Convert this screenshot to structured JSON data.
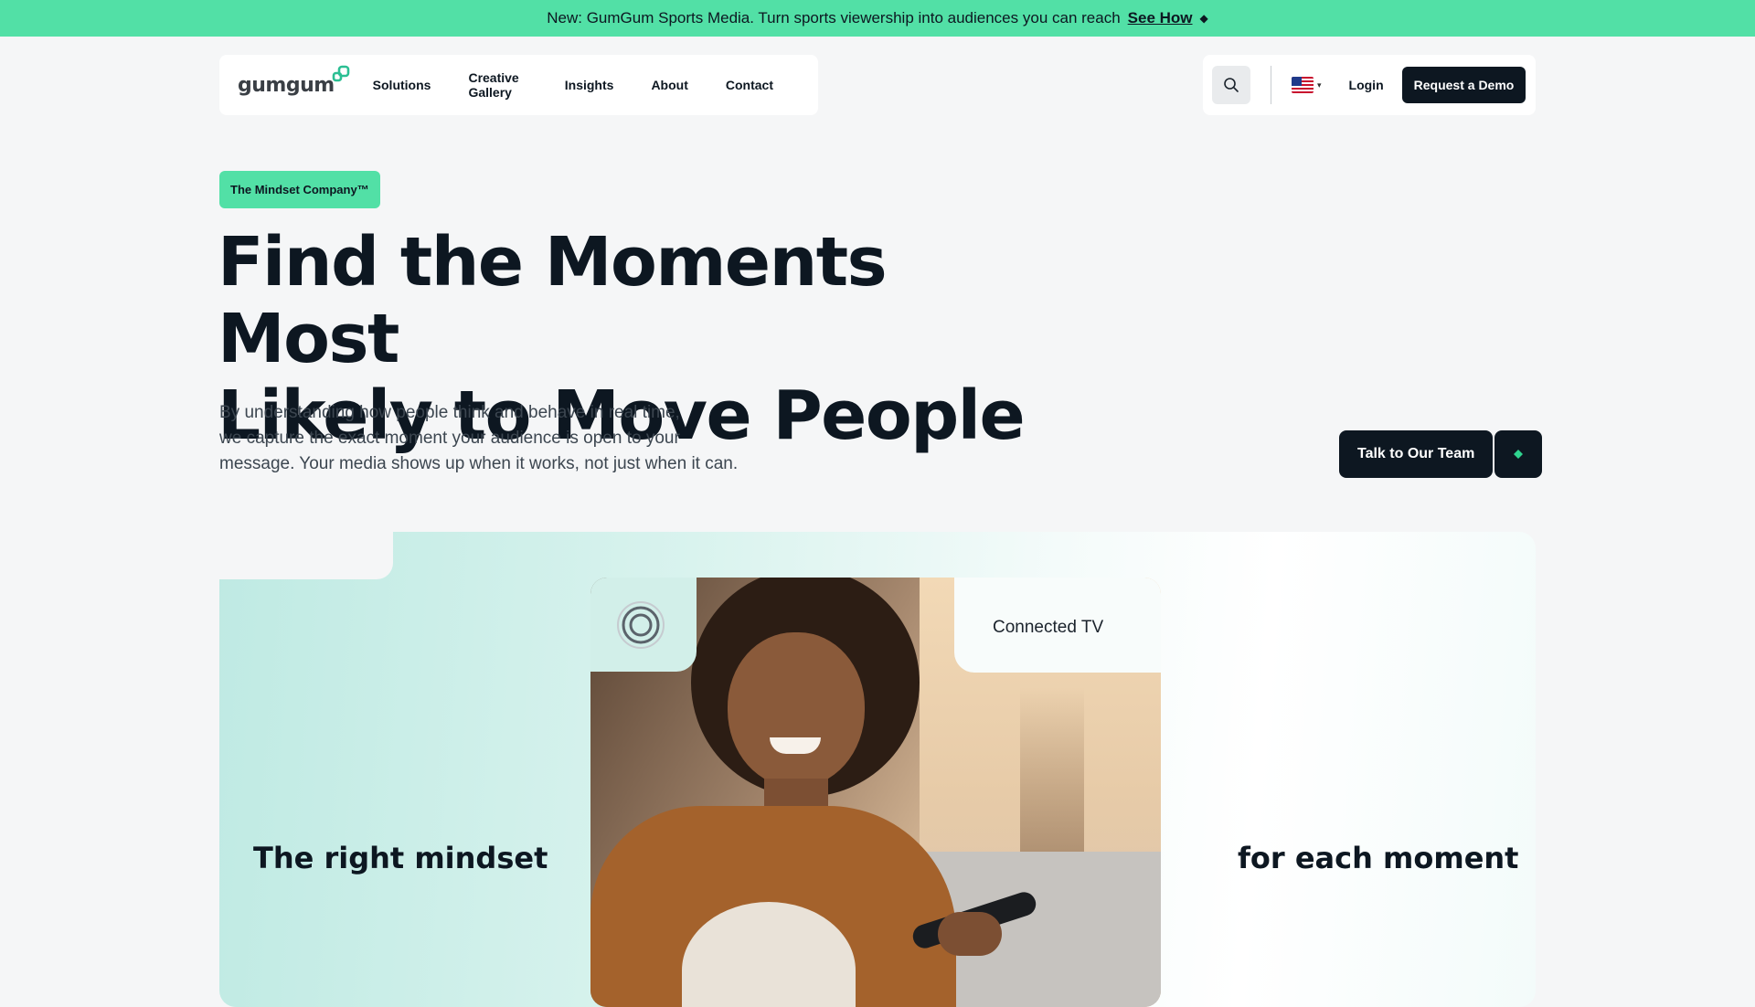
{
  "announcement": {
    "text": "New: GumGum Sports Media. Turn sports viewership into audiences you can reach",
    "link_label": "See How",
    "icon": "diamond-icon"
  },
  "nav": {
    "logo_text": "gumgum",
    "items": [
      {
        "label": "Solutions"
      },
      {
        "label": "Creative Gallery"
      },
      {
        "label": "Insights"
      },
      {
        "label": "About"
      },
      {
        "label": "Contact"
      }
    ],
    "search_icon": "search-icon",
    "language_icon": "us-flag-icon",
    "login_label": "Login",
    "demo_label": "Request a Demo"
  },
  "hero": {
    "badge": "The Mindset Company™",
    "headline_line1": "Find the Moments Most",
    "headline_line2": "Likely to Move People",
    "sub_line1": "By understanding how people think and behave in real time,",
    "sub_line2": "we capture the exact moment your audience is open to your",
    "sub_line3": "message. Your media shows up when it works, not just when it can.",
    "cta_label": "Talk to Our Team",
    "cta_icon": "diamond-icon"
  },
  "showcase": {
    "channel_label": "Connected TV",
    "left_tag": "The right mindset",
    "right_tag": "for each moment",
    "target_icon": "target-icon"
  },
  "colors": {
    "accent": "#52e0a6",
    "dark": "#0d1721",
    "background": "#f5f6f7"
  }
}
